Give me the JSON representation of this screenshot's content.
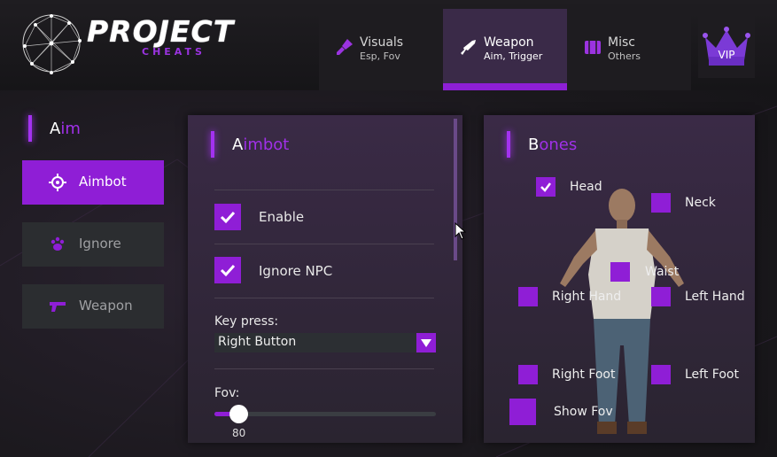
{
  "brand": {
    "title": "PROJECT",
    "subtitle": "CHEATS"
  },
  "tabs": [
    {
      "label": "Visuals",
      "sub": "Esp, Fov",
      "icon": "brush-icon"
    },
    {
      "label": "Weapon",
      "sub": "Aim, Trigger",
      "icon": "rifle-icon",
      "active": true
    },
    {
      "label": "Misc",
      "sub": "Others",
      "icon": "chest-icon"
    }
  ],
  "vip": {
    "label": "VIP",
    "icon": "crown-icon"
  },
  "left": {
    "title_first": "A",
    "title_rest": "im",
    "items": [
      {
        "label": "Aimbot",
        "icon": "crosshair-icon",
        "active": true
      },
      {
        "label": "Ignore",
        "icon": "paw-icon",
        "active": false
      },
      {
        "label": "Weapon",
        "icon": "pistol-icon",
        "active": false
      }
    ]
  },
  "aimbot": {
    "title_first": "A",
    "title_rest": "imbot",
    "enable_label": "Enable",
    "enable_checked": true,
    "ignore_npc_label": "Ignore NPC",
    "ignore_npc_checked": true,
    "key_press_label": "Key press:",
    "key_press_value": "Right Button",
    "fov_label": "Fov:",
    "fov_value": "80"
  },
  "bones": {
    "title_first": "B",
    "title_rest": "ones",
    "head": {
      "label": "Head",
      "checked": true
    },
    "neck": {
      "label": "Neck",
      "checked": false
    },
    "waist": {
      "label": "Waist",
      "checked": false
    },
    "right_hand": {
      "label": "Right Hand",
      "checked": false
    },
    "left_hand": {
      "label": "Left Hand",
      "checked": false
    },
    "right_foot": {
      "label": "Right Foot",
      "checked": false
    },
    "left_foot": {
      "label": "Left Foot",
      "checked": false
    },
    "show_fov": {
      "label": "Show Fov",
      "checked": false
    }
  },
  "colors": {
    "accent": "#8f1ed6",
    "accent_text": "#a030e8",
    "background": "#1a181c"
  }
}
